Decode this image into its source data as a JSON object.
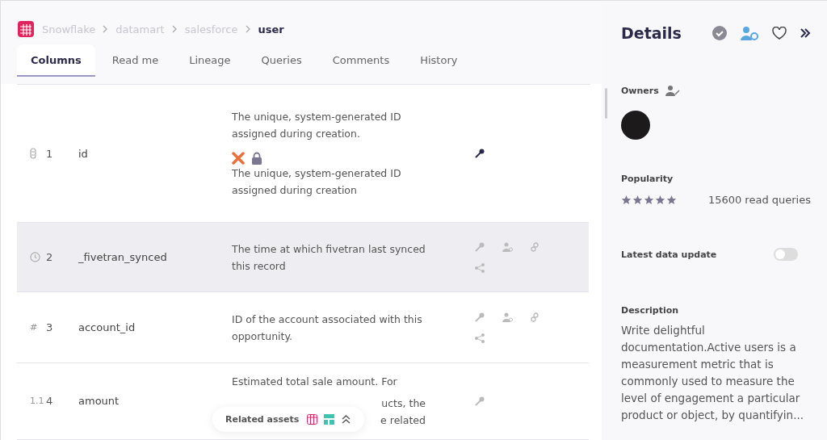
{
  "breadcrumb": [
    {
      "label": "Snowflake",
      "current": false
    },
    {
      "label": "datamart",
      "current": false
    },
    {
      "label": "salesforce",
      "current": false
    },
    {
      "label": "user",
      "current": true
    }
  ],
  "tabs": [
    {
      "label": "Columns",
      "selected": true
    },
    {
      "label": "Read me",
      "selected": false
    },
    {
      "label": "Lineage",
      "selected": false
    },
    {
      "label": "Queries",
      "selected": false
    },
    {
      "label": "Comments",
      "selected": false
    },
    {
      "label": "History",
      "selected": false
    }
  ],
  "columns": [
    {
      "kind": "text",
      "number": "1",
      "name": "id",
      "hovered": false,
      "description": "The unique, system-generated ID assigned during creation.",
      "badges": [
        {
          "kind": "tool"
        },
        {
          "kind": "lock"
        }
      ],
      "source_description": "The unique, system-generated ID assigned during creation",
      "actions": [
        {
          "kind": "key",
          "active": true
        }
      ]
    },
    {
      "kind": "time",
      "number": "2",
      "name": "_fivetran_synced",
      "hovered": true,
      "description": "The time at which fivetran last synced this record",
      "actions": [
        {
          "kind": "key",
          "active": false
        },
        {
          "kind": "owner",
          "active": false
        },
        {
          "kind": "link",
          "active": false
        },
        {
          "kind": "share",
          "active": false
        }
      ]
    },
    {
      "kind": "glyph",
      "type_glyph": "#",
      "number": "3",
      "name": "account_id",
      "hovered": false,
      "description": "ID of the account associated with this opportunity.",
      "actions": [
        {
          "kind": "key",
          "active": false
        },
        {
          "kind": "owner",
          "active": false
        },
        {
          "kind": "link",
          "active": false
        },
        {
          "kind": "share",
          "active": false
        }
      ]
    },
    {
      "kind": "glyph",
      "type_glyph": "1.1",
      "number": "4",
      "name": "amount",
      "hovered": false,
      "description": "Estimated total sale amount. For",
      "description_fragments": [
        "ucts, the",
        "e related"
      ],
      "actions": [
        {
          "kind": "key",
          "active": false
        }
      ]
    }
  ],
  "related_assets": {
    "label": "Related assets"
  },
  "details": {
    "title": "Details",
    "owners": {
      "label": "Owners"
    },
    "popularity": {
      "label": "Popularity",
      "stars": 5,
      "reading": "15600 read queries"
    },
    "latest_update": {
      "label": "Latest data update",
      "on": false
    },
    "description": {
      "label": "Description",
      "text": "Write delightful documentation.Active users is a measurement metric that is commonly used to measure the level of engagement a particular product or object, by quantifyin..."
    }
  }
}
